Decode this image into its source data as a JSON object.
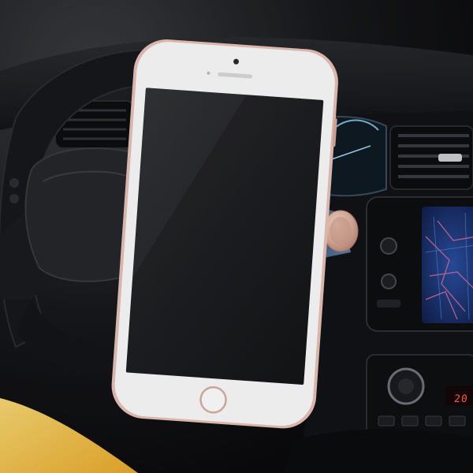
{
  "scene": {
    "description_kind": "product-photo",
    "palette": {
      "dashboard": "#141518",
      "phone_frame": "#fbfbfb",
      "phone_bezel_rose_gold": "#e7c1b6",
      "phone_screen": "#1c1d20",
      "mount_blue": "#4a6fa0",
      "mount_rose_gold": "#e0b4a4",
      "accent_yellow": "#f2c34e",
      "nav_screen_blue": "#1b2f6d",
      "nav_route_pink": "#d56b9a",
      "display_red": "#ff5a3a"
    }
  },
  "climate_display": {
    "value": "20"
  }
}
